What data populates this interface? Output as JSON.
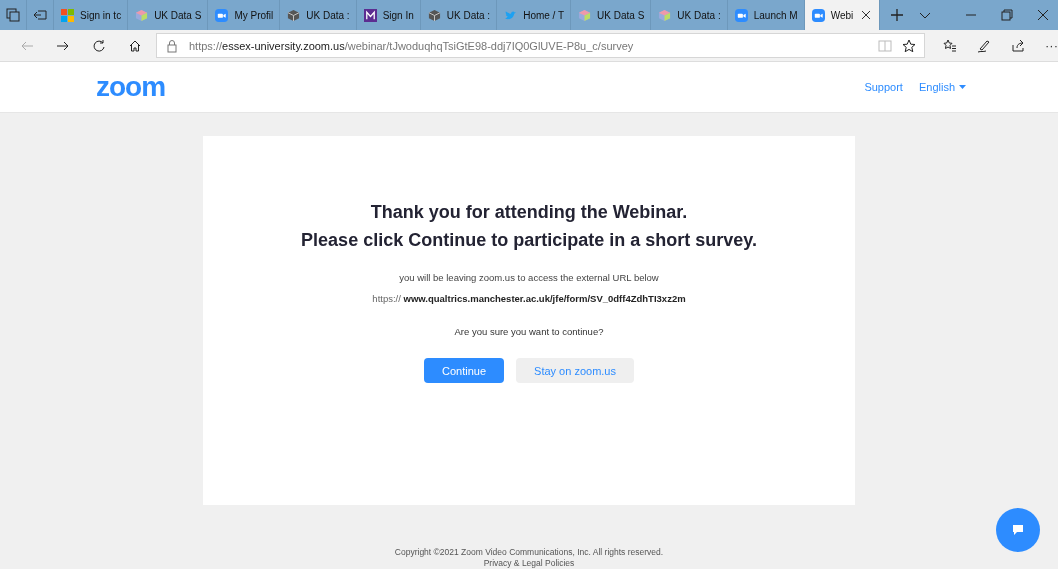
{
  "browser": {
    "tabs": [
      {
        "label": "Sign in tc",
        "kind": "windows",
        "selected": false
      },
      {
        "label": "UK Data S",
        "kind": "cube-color",
        "selected": false
      },
      {
        "label": "My Profil",
        "kind": "camera",
        "selected": false
      },
      {
        "label": "UK Data :",
        "kind": "cube-dark",
        "selected": false
      },
      {
        "label": "Sign In",
        "kind": "m",
        "selected": false
      },
      {
        "label": "UK Data :",
        "kind": "cube-dark",
        "selected": false
      },
      {
        "label": "Home / T",
        "kind": "bird",
        "selected": false
      },
      {
        "label": "UK Data S",
        "kind": "cube-color",
        "selected": false
      },
      {
        "label": "UK Data :",
        "kind": "cube-color",
        "selected": false
      },
      {
        "label": "Launch M",
        "kind": "camera",
        "selected": false
      },
      {
        "label": "Webi",
        "kind": "camera",
        "selected": true
      }
    ],
    "address": {
      "prefix": "https://",
      "host": "essex-university.zoom.us",
      "path": "/webinar/tJwoduqhqTsiGtE98-ddj7IQ0GlUVE-P8u_c/survey"
    },
    "more": "···"
  },
  "header": {
    "logo": "zoom",
    "links": [
      "Support",
      "English"
    ]
  },
  "card": {
    "title": "Thank you for attending the Webinar.",
    "subtitle": "Please click Continue to participate in a short survey.",
    "notice": "you will be leaving zoom.us to access the external URL below",
    "url_prefix": "https://",
    "url": "www.qualtrics.manchester.ac.uk/jfe/form/SV_0dff4ZdhTI3xz2m",
    "question": "Are you sure you want to continue?",
    "buttons": [
      {
        "label": "Continue",
        "kind": "primary"
      },
      {
        "label": "Stay on zoom.us",
        "kind": "secondary"
      }
    ]
  },
  "footer": {
    "copyright": "Copyright ©2021 Zoom Video Communications, Inc. All rights reserved.",
    "policies": "Privacy & Legal Policies"
  }
}
